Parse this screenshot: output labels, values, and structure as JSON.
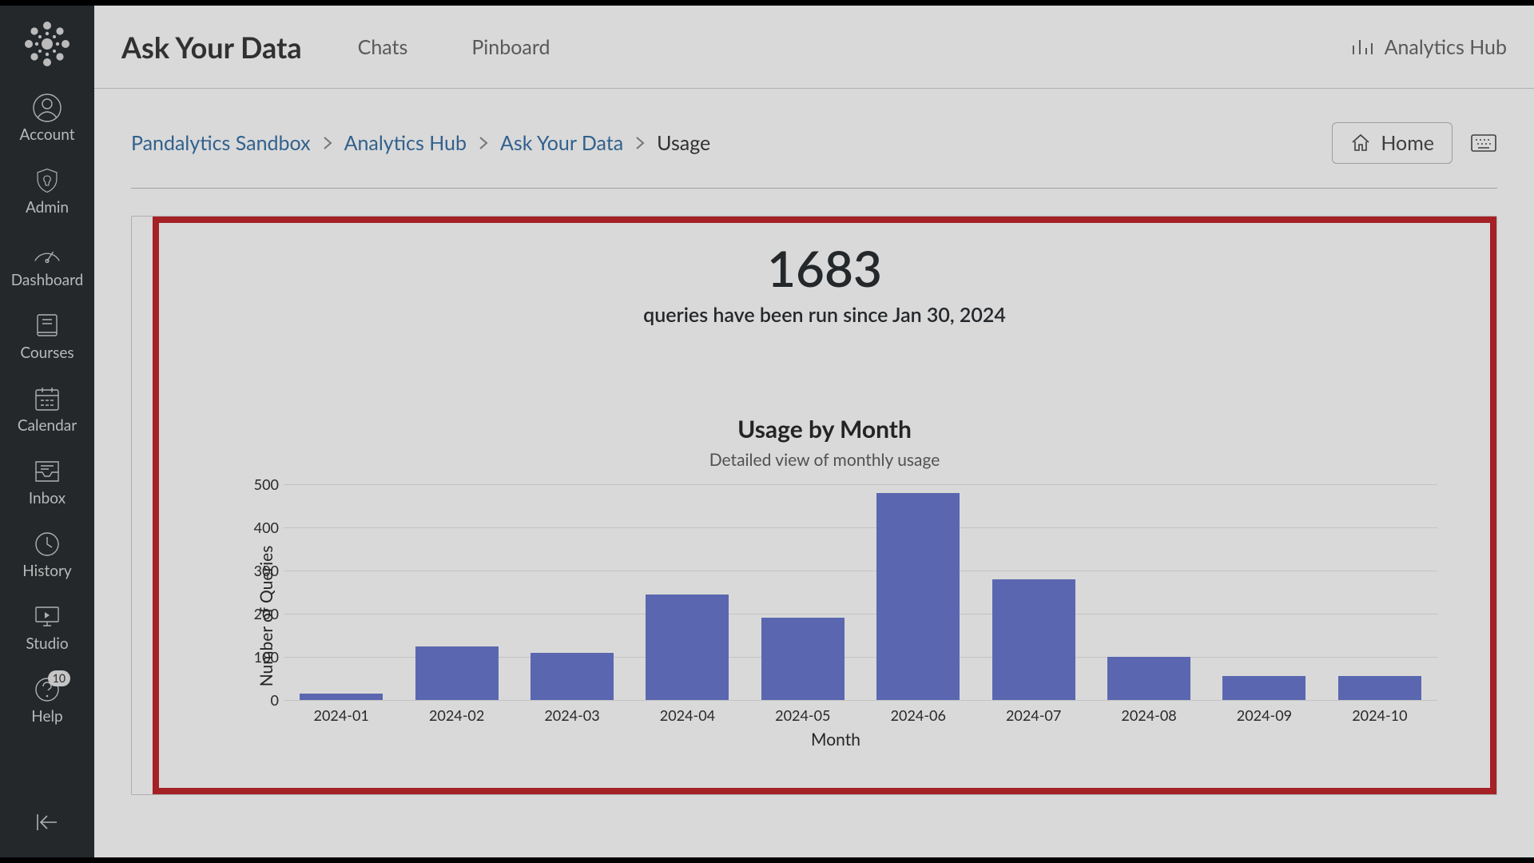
{
  "sidebar": {
    "items": [
      {
        "label": "Account",
        "icon": "user-circle-icon"
      },
      {
        "label": "Admin",
        "icon": "shield-icon"
      },
      {
        "label": "Dashboard",
        "icon": "gauge-icon"
      },
      {
        "label": "Courses",
        "icon": "book-icon"
      },
      {
        "label": "Calendar",
        "icon": "calendar-icon"
      },
      {
        "label": "Inbox",
        "icon": "inbox-icon"
      },
      {
        "label": "History",
        "icon": "clock-icon"
      },
      {
        "label": "Studio",
        "icon": "monitor-icon"
      },
      {
        "label": "Help",
        "icon": "help-icon",
        "badge": "10"
      }
    ]
  },
  "topbar": {
    "title": "Ask Your Data",
    "tabs": [
      "Chats",
      "Pinboard"
    ],
    "analytics_hub": "Analytics Hub"
  },
  "breadcrumb": {
    "items": [
      "Pandalytics Sandbox",
      "Analytics Hub",
      "Ask Your Data"
    ],
    "current": "Usage",
    "home_label": "Home"
  },
  "metric": {
    "value": "1683",
    "subtitle": "queries have been run since Jan 30, 2024"
  },
  "chart_data": {
    "type": "bar",
    "title": "Usage by Month",
    "subtitle": "Detailed view of monthly usage",
    "xlabel": "Month",
    "ylabel": "Number of Queries",
    "ylim": [
      0,
      500
    ],
    "y_ticks": [
      0,
      100,
      200,
      300,
      400,
      500
    ],
    "categories": [
      "2024-01",
      "2024-02",
      "2024-03",
      "2024-04",
      "2024-05",
      "2024-06",
      "2024-07",
      "2024-08",
      "2024-09",
      "2024-10"
    ],
    "values": [
      15,
      125,
      110,
      245,
      190,
      480,
      280,
      100,
      55,
      55
    ]
  }
}
